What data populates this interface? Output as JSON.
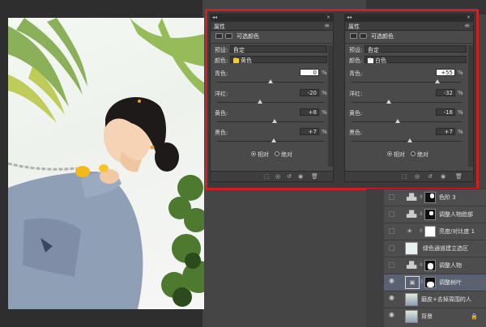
{
  "colors": {
    "highlight": "#d41e1e",
    "panel_bg": "#4a4a4a",
    "swatch_yellow": "#f5d21e",
    "swatch_white": "#ffffff"
  },
  "panel_left": {
    "tab_title": "属性",
    "header_title": "可选颜色",
    "preset_label": "预设:",
    "preset_value": "自定",
    "color_label": "颜色:",
    "color_value": "黄色",
    "sliders": [
      {
        "label": "青色:",
        "value": "0",
        "unit": "%",
        "position": 0.5
      },
      {
        "label": "洋红:",
        "value": "-20",
        "unit": "%",
        "position": 0.4
      },
      {
        "label": "黄色:",
        "value": "+8",
        "unit": "%",
        "position": 0.54
      },
      {
        "label": "黑色:",
        "value": "+7",
        "unit": "%",
        "position": 0.535
      }
    ],
    "method_relative": "相对",
    "method_absolute": "绝对",
    "selected_method": "relative"
  },
  "panel_right": {
    "tab_title": "属性",
    "header_title": "可选颜色",
    "preset_label": "预设:",
    "preset_value": "自定",
    "color_label": "颜色:",
    "color_value": "白色",
    "sliders": [
      {
        "label": "青色:",
        "value": "+55",
        "unit": "%",
        "position": 0.775
      },
      {
        "label": "洋红:",
        "value": "-32",
        "unit": "%",
        "position": 0.34
      },
      {
        "label": "黄色:",
        "value": "-16",
        "unit": "%",
        "position": 0.42
      },
      {
        "label": "黑色:",
        "value": "+7",
        "unit": "%",
        "position": 0.535
      }
    ],
    "method_relative": "相对",
    "method_absolute": "绝对",
    "selected_method": "relative"
  },
  "layers": [
    {
      "name": "色阶 3",
      "type": "adjustment",
      "visible": false
    },
    {
      "name": "调整人物脸部",
      "type": "adjustment",
      "visible": false
    },
    {
      "name": "亮度/对比度 1",
      "type": "adjustment",
      "visible": false
    },
    {
      "name": "绿色通道建立选区",
      "type": "pixel",
      "visible": false
    },
    {
      "name": "调整人物",
      "type": "adjustment",
      "visible": false
    },
    {
      "name": "调整树叶",
      "type": "adjustment",
      "visible": true,
      "active": true
    },
    {
      "name": "磨皮+去掉周围的人",
      "type": "pixel",
      "visible": true
    },
    {
      "name": "背景",
      "type": "pixel",
      "visible": true
    }
  ]
}
